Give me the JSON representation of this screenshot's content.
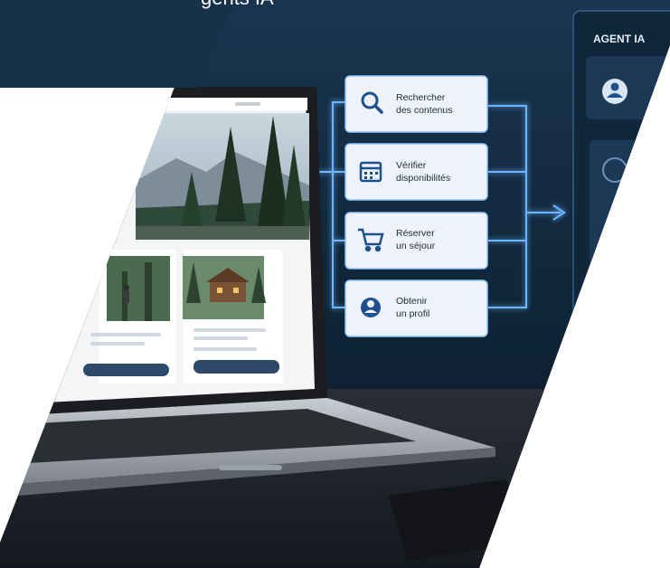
{
  "header": {
    "title_fragment": "gents IA"
  },
  "agent_panel": {
    "title": "AGENT IA"
  },
  "actions": [
    {
      "icon": "search-icon",
      "line1": "Rechercher",
      "line2": "des contenus"
    },
    {
      "icon": "calendar-icon",
      "line1": "Vérifier",
      "line2": "disponibilités"
    },
    {
      "icon": "cart-icon",
      "line1": "Réserver",
      "line2": "un séjour"
    },
    {
      "icon": "user-icon",
      "line1": "Obtenir",
      "line2": "un profil"
    }
  ],
  "colors": {
    "background_dark": "#0f2235",
    "header_band": "#16324a",
    "glow": "#4fa3ff",
    "card": "#eef3f9",
    "icon_blue": "#1e4f8f"
  }
}
